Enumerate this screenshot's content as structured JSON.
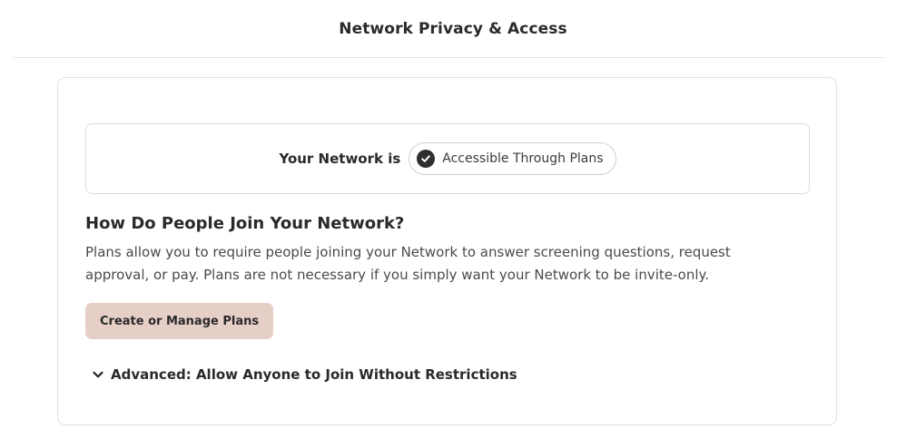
{
  "header": {
    "title": "Network Privacy & Access"
  },
  "status": {
    "label": "Your Network is",
    "value": "Accessible Through Plans",
    "icon": "check-circle-icon"
  },
  "join_section": {
    "heading": "How Do People Join Your Network?",
    "description": "Plans allow you to require people joining your Network to answer screening questions, request approval, or pay. Plans are not necessary if you simply want your Network to be invite-only.",
    "button_label": "Create or Manage Plans"
  },
  "advanced": {
    "label": "Advanced: Allow Anyone to Join Without Restrictions",
    "icon": "chevron-down-icon",
    "expanded": false
  },
  "colors": {
    "button_bg": "#e6cfc7",
    "text_primary": "#2a2a2a",
    "text_secondary": "#4a4a4a",
    "border": "#e2e2e2"
  }
}
